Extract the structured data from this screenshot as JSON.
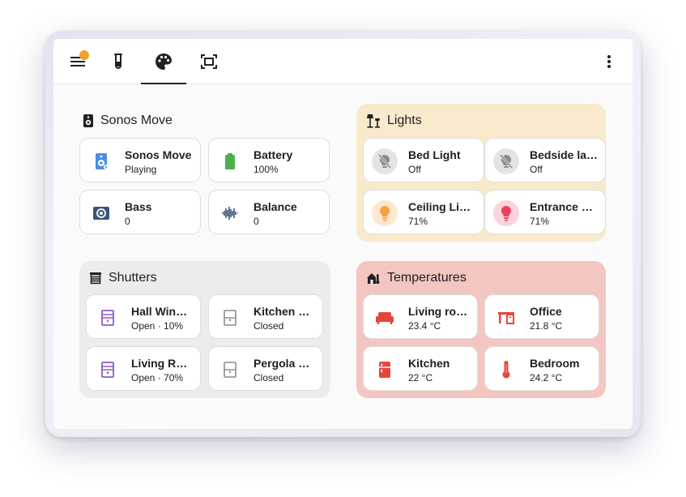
{
  "colors": {
    "lights_bg": "#f8eacb",
    "shutters_bg": "#ececec",
    "temperatures_bg": "#f3c6c1",
    "speaker_blue": "#4a90e2",
    "battery_green": "#4caf50",
    "bass_navy": "#3b5578",
    "shutter_purple": "#8e5bc7",
    "shutter_grey": "#8c8c8c",
    "temp_red": "#e5463b",
    "light_on_orange": "#f5a142",
    "light_on_pink": "#ef3e60",
    "notification_dot": "#f0a030"
  },
  "topbar": {
    "icons": [
      "menu-icon",
      "test-tube-icon",
      "palette-icon",
      "fullscreen-icon",
      "dots-vertical-icon"
    ],
    "active_tab": "palette"
  },
  "sonos": {
    "title": "Sonos Move",
    "tiles": [
      {
        "name": "Sonos Move",
        "state": "Playing",
        "icon": "speaker-icon"
      },
      {
        "name": "Battery",
        "state": "100%",
        "icon": "battery-icon"
      },
      {
        "name": "Bass",
        "state": "0",
        "icon": "bass-speaker-icon"
      },
      {
        "name": "Balance",
        "state": "0",
        "icon": "waveform-icon"
      }
    ]
  },
  "lights": {
    "title": "Lights",
    "tiles": [
      {
        "name": "Bed Light",
        "state": "Off",
        "icon": "bulb-off-icon"
      },
      {
        "name": "Bedside lamp",
        "state": "Off",
        "icon": "bulb-off-icon"
      },
      {
        "name": "Ceiling Lights",
        "state": "71%",
        "icon": "bulb-on-icon"
      },
      {
        "name": "Entrance Color + White Lights",
        "state": "71%",
        "icon": "bulb-on-icon"
      }
    ]
  },
  "shutters": {
    "title": "Shutters",
    "tiles": [
      {
        "name": "Hall Window",
        "state": "Open · 10%",
        "icon": "window-shutter-open-icon"
      },
      {
        "name": "Kitchen Window",
        "state": "Closed",
        "icon": "window-shutter-closed-icon"
      },
      {
        "name": "Living Room Window",
        "state": "Open · 70%",
        "icon": "window-shutter-open-icon"
      },
      {
        "name": "Pergola Roof",
        "state": "Closed",
        "icon": "window-shutter-closed-icon"
      }
    ]
  },
  "temperatures": {
    "title": "Temperatures",
    "tiles": [
      {
        "name": "Living room",
        "state": "23.4 °C",
        "icon": "sofa-icon"
      },
      {
        "name": "Office",
        "state": "21.8 °C",
        "icon": "desk-icon"
      },
      {
        "name": "Kitchen",
        "state": "22 °C",
        "icon": "fridge-icon"
      },
      {
        "name": "Bedroom",
        "state": "24.2 °C",
        "icon": "thermometer-icon"
      }
    ]
  }
}
